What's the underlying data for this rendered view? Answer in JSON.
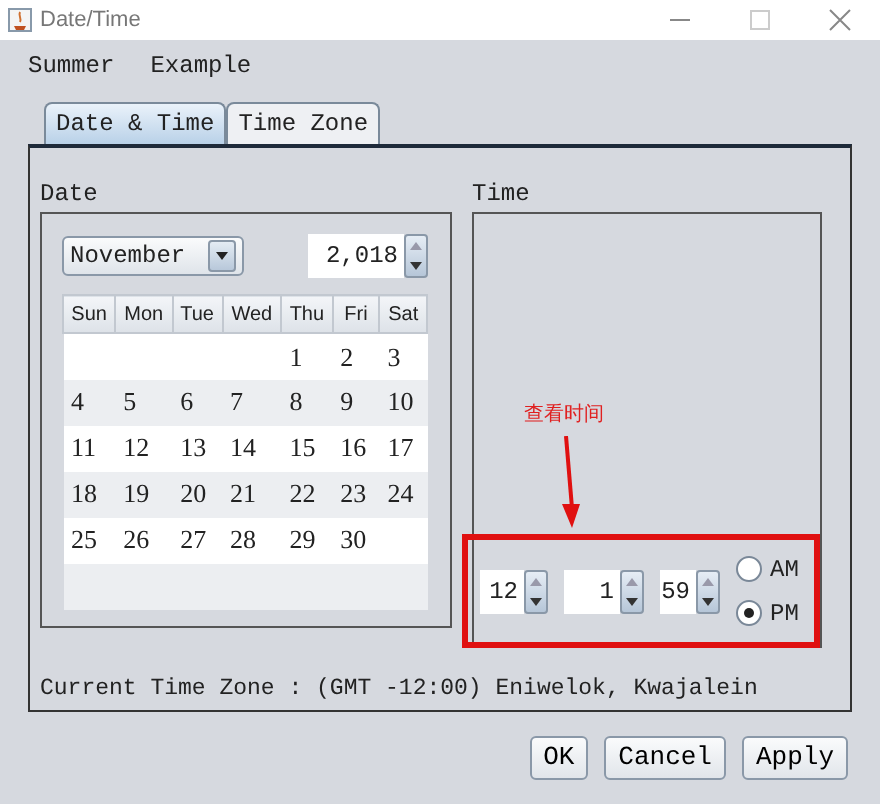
{
  "window": {
    "title": "Date/Time"
  },
  "menu": [
    "Summer",
    "Example"
  ],
  "tabs": [
    {
      "label": "Date & Time",
      "selected": true
    },
    {
      "label": "Time Zone",
      "selected": false
    }
  ],
  "date": {
    "title": "Date",
    "month": "November",
    "year": "2,018",
    "weekdays": [
      "Sun",
      "Mon",
      "Tue",
      "Wed",
      "Thu",
      "Fri",
      "Sat"
    ],
    "weeks": [
      {
        "right_aligned": true,
        "days": [
          "1",
          "2",
          "3"
        ]
      },
      {
        "days": [
          "4",
          "5",
          "6",
          "7",
          "8",
          "9",
          "10"
        ]
      },
      {
        "days": [
          "11",
          "12",
          "13",
          "14",
          "15",
          "16",
          "17"
        ]
      },
      {
        "days": [
          "18",
          "19",
          "20",
          "21",
          "22",
          "23",
          "24"
        ]
      },
      {
        "right_aligned": false,
        "days": [
          "25",
          "26",
          "27",
          "28",
          "29",
          "30"
        ]
      }
    ]
  },
  "time": {
    "title": "Time",
    "annotation": "查看时间",
    "spinners": [
      "12",
      "1",
      "59"
    ],
    "periods": [
      {
        "label": "AM",
        "selected": false
      },
      {
        "label": "PM",
        "selected": true
      }
    ]
  },
  "current_zone": "Current Time Zone : (GMT -12:00) Eniwelok, Kwajalein",
  "buttons": [
    "OK",
    "Cancel",
    "Apply"
  ]
}
